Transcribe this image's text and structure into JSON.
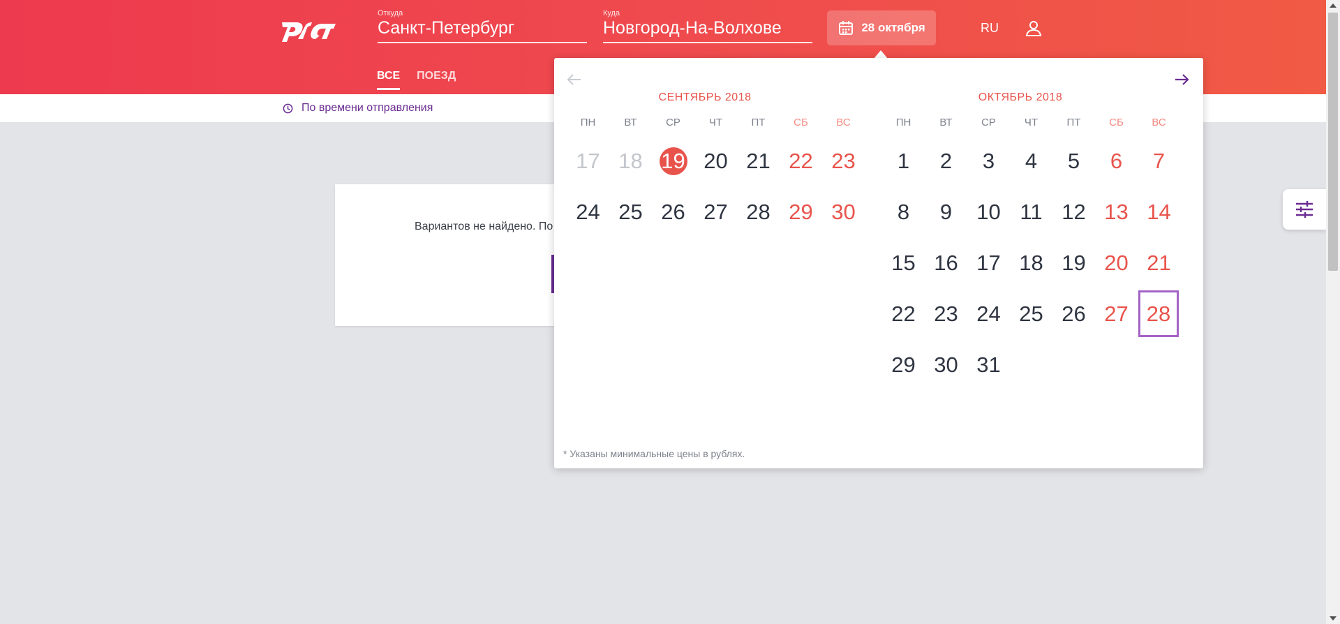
{
  "header": {
    "from_label": "Откуда",
    "from_value": "Санкт-Петербург",
    "to_label": "Куда",
    "to_value": "Новгород-На-Волхове",
    "date_button": "28 октября",
    "language": "RU",
    "tabs": [
      {
        "label": "ВСЕ",
        "active": true
      },
      {
        "label": "ПОЕЗД",
        "active": false
      }
    ]
  },
  "sortbar": {
    "label": "По времени отправления",
    "icon": "clock-icon"
  },
  "results": {
    "message": "Вариантов не найдено. По"
  },
  "calendar": {
    "months": [
      {
        "title": "СЕНТЯБРЬ 2018",
        "weekdays": [
          "ПН",
          "ВТ",
          "СР",
          "ЧТ",
          "ПТ",
          "СБ",
          "ВС"
        ],
        "days": [
          {
            "d": "17",
            "state": "past"
          },
          {
            "d": "18",
            "state": "past"
          },
          {
            "d": "19",
            "state": "today"
          },
          {
            "d": "20",
            "state": ""
          },
          {
            "d": "21",
            "state": ""
          },
          {
            "d": "22",
            "state": "we"
          },
          {
            "d": "23",
            "state": "we"
          },
          {
            "d": "24",
            "state": ""
          },
          {
            "d": "25",
            "state": ""
          },
          {
            "d": "26",
            "state": ""
          },
          {
            "d": "27",
            "state": ""
          },
          {
            "d": "28",
            "state": ""
          },
          {
            "d": "29",
            "state": "we"
          },
          {
            "d": "30",
            "state": "we"
          }
        ]
      },
      {
        "title": "ОКТЯБРЬ 2018",
        "weekdays": [
          "ПН",
          "ВТ",
          "СР",
          "ЧТ",
          "ПТ",
          "СБ",
          "ВС"
        ],
        "days": [
          {
            "d": "1",
            "state": ""
          },
          {
            "d": "2",
            "state": ""
          },
          {
            "d": "3",
            "state": ""
          },
          {
            "d": "4",
            "state": ""
          },
          {
            "d": "5",
            "state": ""
          },
          {
            "d": "6",
            "state": "we"
          },
          {
            "d": "7",
            "state": "we"
          },
          {
            "d": "8",
            "state": ""
          },
          {
            "d": "9",
            "state": ""
          },
          {
            "d": "10",
            "state": ""
          },
          {
            "d": "11",
            "state": ""
          },
          {
            "d": "12",
            "state": ""
          },
          {
            "d": "13",
            "state": "we"
          },
          {
            "d": "14",
            "state": "we"
          },
          {
            "d": "15",
            "state": ""
          },
          {
            "d": "16",
            "state": ""
          },
          {
            "d": "17",
            "state": ""
          },
          {
            "d": "18",
            "state": ""
          },
          {
            "d": "19",
            "state": ""
          },
          {
            "d": "20",
            "state": "we"
          },
          {
            "d": "21",
            "state": "we"
          },
          {
            "d": "22",
            "state": ""
          },
          {
            "d": "23",
            "state": ""
          },
          {
            "d": "24",
            "state": ""
          },
          {
            "d": "25",
            "state": ""
          },
          {
            "d": "26",
            "state": ""
          },
          {
            "d": "27",
            "state": "we"
          },
          {
            "d": "28",
            "state": "we selected"
          },
          {
            "d": "29",
            "state": ""
          },
          {
            "d": "30",
            "state": ""
          },
          {
            "d": "31",
            "state": ""
          }
        ]
      }
    ],
    "note": "* Указаны минимальные цены в рублях."
  },
  "colors": {
    "brand_red": "#e8544c",
    "accent_purple": "#6a2c91",
    "selected_outline": "#a463c7"
  }
}
